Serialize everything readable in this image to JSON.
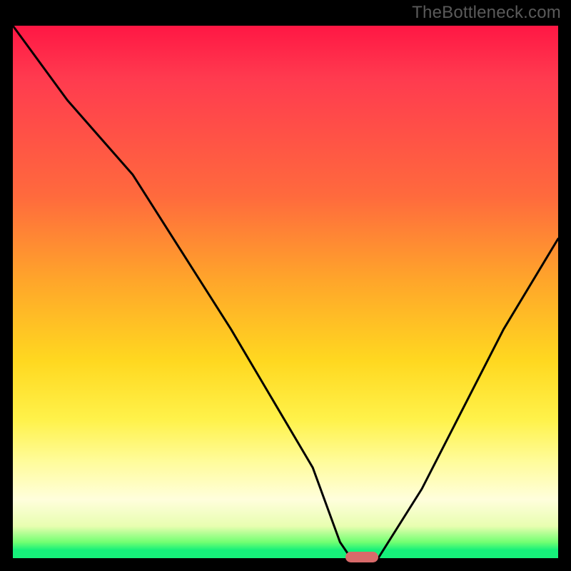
{
  "watermark": "TheBottleneck.com",
  "chart_data": {
    "type": "line",
    "title": "",
    "xlabel": "",
    "ylabel": "",
    "xlim": [
      0,
      100
    ],
    "ylim": [
      0,
      100
    ],
    "grid": false,
    "series": [
      {
        "name": "curve",
        "x": [
          0,
          10,
          22,
          40,
          55,
          60,
          62,
          67,
          75,
          90,
          100
        ],
        "values": [
          100,
          86,
          72,
          43,
          17,
          3,
          0,
          0,
          13,
          43,
          60
        ]
      }
    ],
    "marker": {
      "x": 64,
      "y": 0
    },
    "gradient_stops": [
      {
        "pos": 0,
        "color": "#ff1744"
      },
      {
        "pos": 0.1,
        "color": "#ff3b4f"
      },
      {
        "pos": 0.32,
        "color": "#ff6a3d"
      },
      {
        "pos": 0.48,
        "color": "#ffa62a"
      },
      {
        "pos": 0.63,
        "color": "#ffd820"
      },
      {
        "pos": 0.74,
        "color": "#fff24a"
      },
      {
        "pos": 0.82,
        "color": "#fffc9c"
      },
      {
        "pos": 0.89,
        "color": "#fffedc"
      },
      {
        "pos": 0.94,
        "color": "#e8feb0"
      },
      {
        "pos": 0.97,
        "color": "#72ff72"
      },
      {
        "pos": 0.985,
        "color": "#16f07a"
      },
      {
        "pos": 1.0,
        "color": "#16f07a"
      }
    ]
  },
  "colors": {
    "frame": "#000000",
    "curve": "#000000",
    "marker": "#d86a6a",
    "watermark": "#5a5a5a"
  }
}
